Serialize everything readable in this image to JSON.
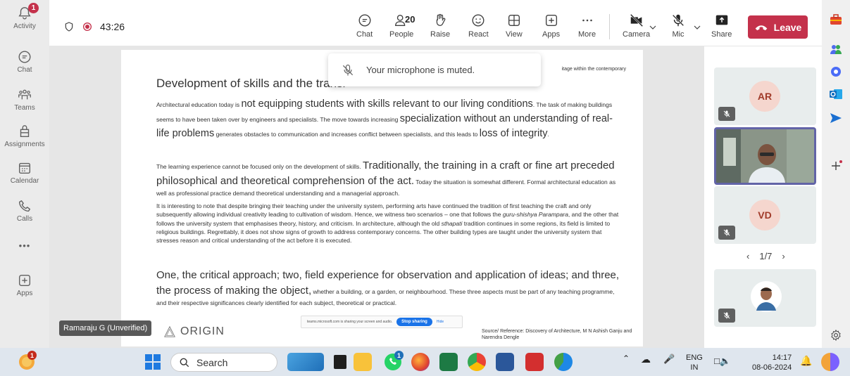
{
  "rail": {
    "activity": "Activity",
    "activity_badge": "1",
    "chat": "Chat",
    "teams": "Teams",
    "assignments": "Assignments",
    "calendar": "Calendar",
    "calls": "Calls",
    "more": "•••",
    "apps": "Apps"
  },
  "topbar": {
    "timer": "43:26",
    "chat": "Chat",
    "people": "People",
    "people_count": "20",
    "raise": "Raise",
    "react": "React",
    "view": "View",
    "apps": "Apps",
    "more": "More",
    "camera": "Camera",
    "mic": "Mic",
    "share": "Share",
    "leave": "Leave"
  },
  "toast": {
    "text": "Your microphone is muted."
  },
  "slide": {
    "corner": "itage within the contemporary",
    "heading": "Development of skills and the transi",
    "p1_a": "Architectural education today is ",
    "p1_b": "not equipping students with skills relevant to our living conditions",
    "p1_c": ". The task of making buildings seems to have been taken over by engineers and specialists. The move towards increasing ",
    "p1_d": "specialization without an understanding of real-life problems",
    "p1_e": " generates obstacles to communication and increases conflict between specialists, and this leads to ",
    "p1_f": "loss of integrity",
    "p1_g": ".",
    "p2_a": "The learning experience cannot be focused only on the development of skills. ",
    "p2_b": "Traditionally, the training in a craft or fine art preceded philosophical and theoretical comprehension of the act.",
    "p2_c": " Today the situation is somewhat different. Formal architectural education as well as professional practice demand theoretical understanding and a managerial approach.",
    "p3_a": "It is interesting to note that despite bringing their teaching under the university system, performing arts have continued the tradition of first teaching the craft and only subsequently allowing individual creativity leading to cultivation of wisdom. Hence, we witness two scenarios – one that follows the ",
    "p3_b": "guru-shishya Parampara",
    "p3_c": ", and the other that follows the university system that emphasises theory, history, and criticism. In architecture, although the old ",
    "p3_d": "sthapati",
    "p3_e": " tradition continues in some regions, its field is limited to religious buildings. Regrettably, it does not show signs of growth to address contemporary concerns. The other building types are taught under the university system that stresses reason and critical understanding of the act before it is executed.",
    "p4_a": "One, the critical approach; two, field experience for observation and application of ideas; and three, the process of making the object,",
    "p4_b": " whether a building, or a garden, or neighbourhood. These three aspects must be part of any teaching programme, and their respective significances clearly identified for each subject, theoretical or practical.",
    "logo": "ORIGIN",
    "share_text": "teams.microsoft.com is sharing your screen and audio.",
    "stop_sharing": "Stop sharing",
    "hide": "Hide",
    "reference": "Source/ Reference: Discovery of Architecture, M N Ashish Ganju and Narendra Dengle"
  },
  "presenter": {
    "name": "Ramaraju G (Unverified)"
  },
  "gallery": {
    "tile1_initials": "AR",
    "tile3_initials": "VD",
    "pager": "1/7"
  },
  "taskbar": {
    "search": "Search",
    "lang_top": "ENG",
    "lang_bottom": "IN",
    "time": "14:17",
    "date": "08-06-2024",
    "weather_badge": "1",
    "whatsapp_badge": "1"
  },
  "colors": {
    "leave": "#c4314b",
    "accent": "#6264a7",
    "stop_sharing": "#1a73e8"
  }
}
